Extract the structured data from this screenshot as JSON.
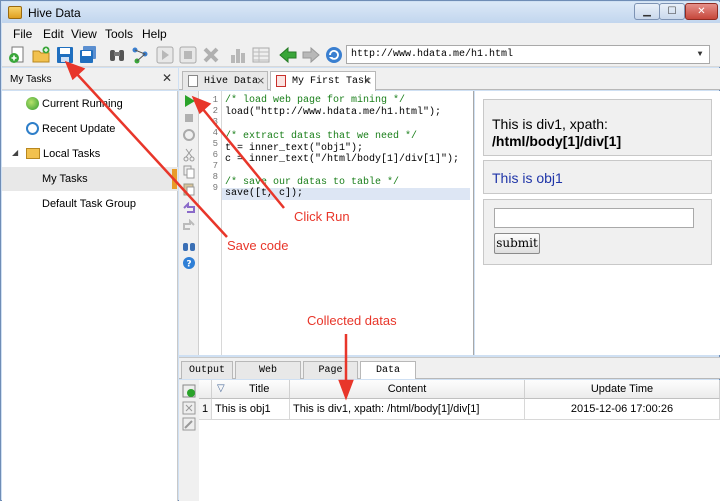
{
  "window": {
    "title": "Hive Data"
  },
  "menu": [
    "File",
    "Edit",
    "View",
    "Tools",
    "Help"
  ],
  "toolbar": {
    "url": "http://www.hdata.me/h1.html"
  },
  "left_panel": {
    "title": "My Tasks",
    "items": [
      {
        "label": "Current Running"
      },
      {
        "label": "Recent Update"
      },
      {
        "label": "Local Tasks"
      },
      {
        "label": "My Tasks"
      },
      {
        "label": "Default Task Group"
      }
    ]
  },
  "editor_tabs": [
    {
      "label": "Hive Data"
    },
    {
      "label": "My First Task"
    }
  ],
  "code": {
    "line_numbers": [
      "1",
      "2",
      "3",
      "4",
      "5",
      "6",
      "7",
      "8",
      "9"
    ],
    "lines": [
      "/* load web page for mining */",
      "load(\"http://www.hdata.me/h1.html\");",
      "",
      "/* extract datas that we need */",
      "t = inner_text(\"obj1\");",
      "c = inner_text(\"/html/body[1]/div[1]\");",
      "",
      "/* save our datas to table */",
      "save([t, c]);"
    ]
  },
  "preview": {
    "div1_line1": "This is div1, xpath:",
    "div1_line2": "/html/body[1]/div[1]",
    "obj1": "This is obj1",
    "submit": "submit"
  },
  "bottom_tabs": [
    {
      "label": "Output"
    },
    {
      "label": "Web Inspector"
    },
    {
      "label": "Page Source"
    },
    {
      "label": "Data Fields"
    }
  ],
  "table": {
    "columns": [
      "Title",
      "Content",
      "Update Time"
    ],
    "rows": [
      {
        "index": "1",
        "title": "This is obj1",
        "content": "This is div1, xpath: /html/body[1]/div[1]",
        "time": "2015-12-06 17:00:26"
      }
    ]
  },
  "annotations": {
    "click_run": "Click Run",
    "save_code": "Save code",
    "collected": "Collected datas"
  },
  "colors": {
    "annotation": "#e8362a",
    "run_icon": "#2aa32a",
    "save_icon": "#1f6fbf"
  }
}
